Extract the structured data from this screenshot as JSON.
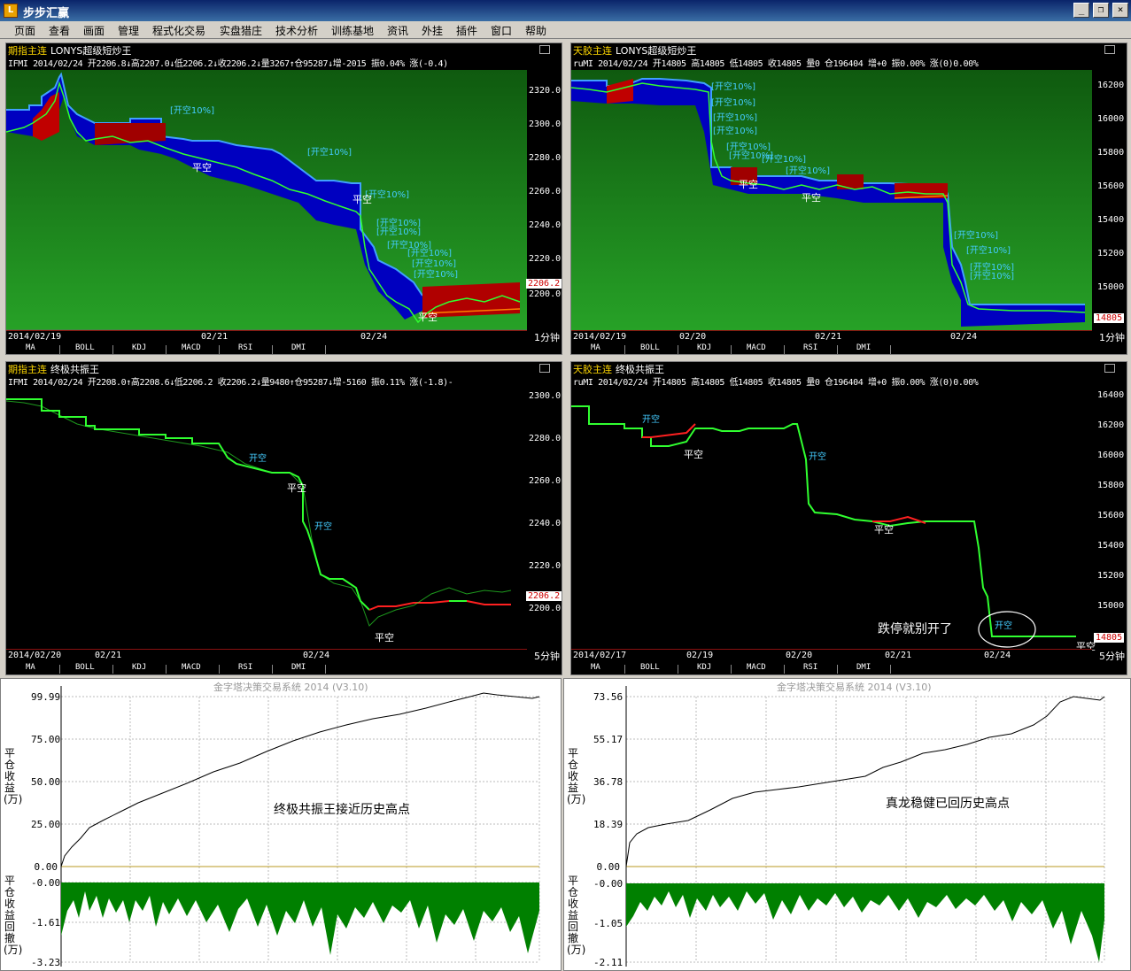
{
  "window": {
    "title": "步步汇赢",
    "icon_name": "app-logo-icon",
    "buttons": {
      "minimize": "_",
      "restore": "❐",
      "close": "×"
    }
  },
  "menu": [
    "页面",
    "查看",
    "画面",
    "管理",
    "程式化交易",
    "实盘猎庄",
    "技术分析",
    "训练基地",
    "资讯",
    "外挂",
    "插件",
    "窗口",
    "帮助"
  ],
  "panels": {
    "tl": {
      "symbol": "期指主连",
      "indicator": "LONYS超级短炒王",
      "quote": "IFMI 2014/02/24 开2206.8↓高2207.0↓低2206.2↓收2206.2↓量3267↑仓95287↓增-2015 振0.04% 涨(-0.4)",
      "yaxis": [
        "2320.0",
        "2300.0",
        "2280.0",
        "2260.0",
        "2240.0",
        "2220.0",
        "2200.0"
      ],
      "price_tag": "2206.2",
      "dates": [
        "2014/02/19",
        "02/21",
        "02/24"
      ],
      "period": "1分钟",
      "tabs": [
        "MA",
        "BOLL",
        "KDJ",
        "MACD",
        "RSI",
        "DMI"
      ],
      "annotations": [
        "[开空10%]",
        "[开空10%]",
        "[开空10%]",
        "[开空10%]",
        "[开空10%]",
        "[开空10%]",
        "[开空10%]",
        "[开空10%]",
        "[开空10%]"
      ],
      "signals": [
        "平空",
        "平空",
        "平空"
      ]
    },
    "tr": {
      "symbol": "天胶主连",
      "indicator": "LONYS超级短炒王",
      "quote": "ruMI 2014/02/24 开14805 高14805 低14805 收14805 量0 仓196404 增+0 振0.00% 涨(0)0.00%",
      "yaxis": [
        "16200",
        "16000",
        "15800",
        "15600",
        "15400",
        "15200",
        "15000"
      ],
      "price_tag": "14805",
      "dates": [
        "2014/02/19",
        "02/20",
        "02/21",
        "02/24"
      ],
      "period": "1分钟",
      "tabs": [
        "MA",
        "BOLL",
        "KDJ",
        "MACD",
        "RSI",
        "DMI"
      ],
      "annotations": [
        "[开空10%]",
        "[开空10%]",
        "[开空10%]",
        "[开空10%]",
        "[开空10%]",
        "[开空10%]",
        "[开空10%]",
        "[开空10%]",
        "[开空10%]",
        "[开空10%]",
        "[开空10%]",
        "[开空10%]",
        "[开空10%]",
        "[开空10%]",
        "[开空10%]",
        "[开空10%]"
      ],
      "signals": [
        "平空",
        "平空"
      ]
    },
    "bl": {
      "symbol": "期指主连",
      "indicator": "终极共振王",
      "quote": "IFMI 2014/02/24 开2208.0↑高2208.6↓低2206.2 收2206.2↓量9480↑仓95287↓增-5160 振0.11% 涨(-1.8)-",
      "yaxis": [
        "2300.0",
        "2280.0",
        "2260.0",
        "2240.0",
        "2220.0",
        "2200.0"
      ],
      "price_tag": "2206.2",
      "dates": [
        "2014/02/20",
        "02/21",
        "02/24"
      ],
      "period": "5分钟",
      "tabs": [
        "MA",
        "BOLL",
        "KDJ",
        "MACD",
        "RSI",
        "DMI"
      ],
      "annotations": [
        "开空",
        "开空"
      ],
      "signals": [
        "平空",
        "平空"
      ]
    },
    "br": {
      "symbol": "天胶主连",
      "indicator": "终极共振王",
      "quote": "ruMI 2014/02/24 开14805 高14805 低14805 收14805 量0 仓196404 增+0 振0.00% 涨(0)0.00%",
      "yaxis": [
        "16400",
        "16200",
        "16000",
        "15800",
        "15600",
        "15400",
        "15200",
        "15000"
      ],
      "price_tag": "14805",
      "dates": [
        "2014/02/17",
        "02/19",
        "02/20",
        "02/21",
        "02/24"
      ],
      "period": "5分钟",
      "tabs": [
        "MA",
        "BOLL",
        "KDJ",
        "MACD",
        "RSI",
        "DMI"
      ],
      "annotations": [
        "开空",
        "开空",
        "开空"
      ],
      "signals": [
        "平空",
        "平空",
        "平空"
      ],
      "note": "跌停就别开了"
    }
  },
  "equity": {
    "left": {
      "system": "金字塔决策交易系统 2014 (V3.10)",
      "yaxis": [
        "99.99",
        "75.00",
        "50.00",
        "25.00",
        "0.00"
      ],
      "dd_axis": [
        "-0.00",
        "-1.61",
        "-3.23"
      ],
      "ylabel": "平仓收益(万)",
      "dd_label": "平仓收益回撤(万)",
      "comment": "终极共振王接近历史高点"
    },
    "right": {
      "system": "金字塔决策交易系统 2014 (V3.10)",
      "yaxis": [
        "73.56",
        "55.17",
        "36.78",
        "18.39",
        "0.00"
      ],
      "dd_axis": [
        "-0.00",
        "-1.05",
        "-2.11"
      ],
      "ylabel": "平仓收益(万)",
      "dd_label": "平仓收益回撤(万)",
      "comment": "真龙稳健已回历史高点"
    }
  },
  "colors": {
    "up_bar": "#ff2020",
    "down_bar": "#20ff20",
    "band_blue": "#0000c0",
    "band_red": "#b00000",
    "chart_bg_green": "#1a7a1a",
    "drawdown_fill": "#008000"
  }
}
